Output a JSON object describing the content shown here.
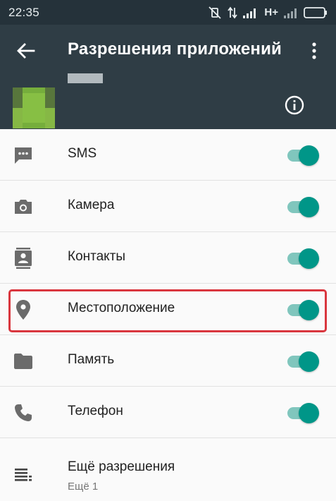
{
  "status_bar": {
    "time": "22:35",
    "network": "H+"
  },
  "app_bar": {
    "title": "Разрешения приложений"
  },
  "permissions": [
    {
      "label": "SMS",
      "icon": "sms-icon",
      "enabled": true
    },
    {
      "label": "Камера",
      "icon": "camera-icon",
      "enabled": true
    },
    {
      "label": "Контакты",
      "icon": "contacts-icon",
      "enabled": true
    },
    {
      "label": "Местоположение",
      "icon": "location-icon",
      "enabled": true
    },
    {
      "label": "Память",
      "icon": "folder-icon",
      "enabled": true
    },
    {
      "label": "Телефон",
      "icon": "phone-icon",
      "enabled": true
    }
  ],
  "more": {
    "label": "Ещё разрешения",
    "sub": "Ещё 1"
  },
  "colors": {
    "accent": "#009688",
    "track": "#80c6bd",
    "app_bar": "#2f3d45",
    "status_bar": "#25323a",
    "highlight": "#d9363e"
  }
}
